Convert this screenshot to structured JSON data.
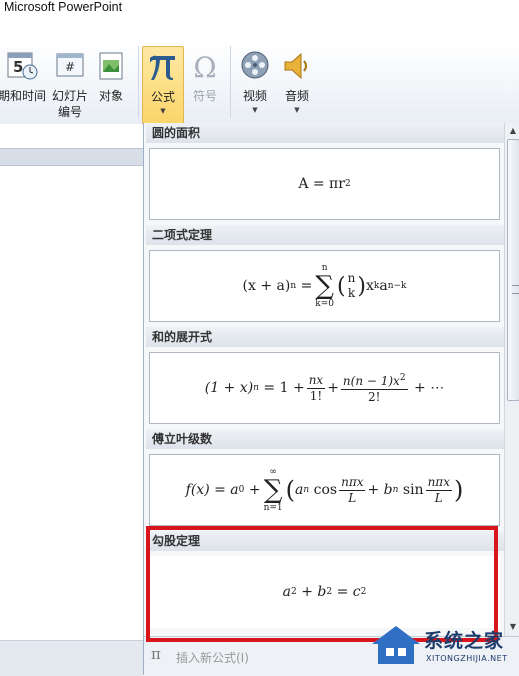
{
  "window": {
    "title": "Microsoft PowerPoint"
  },
  "ribbon": {
    "datetime_label": "期和时间",
    "slide_number_label_line1": "幻灯片",
    "slide_number_label_line2": "编号",
    "object_label": "对象",
    "equation_label": "公式",
    "symbol_label": "符号",
    "video_label": "视频",
    "audio_label": "音频",
    "slide_number_glyph": "#",
    "datetime_glyph": "5"
  },
  "gallery": {
    "sections": [
      {
        "title": "圆的面积"
      },
      {
        "title": "二项式定理"
      },
      {
        "title": "和的展开式"
      },
      {
        "title": "傅立叶级数"
      },
      {
        "title": "勾股定理"
      }
    ],
    "footer": {
      "insert_new_label": "插入新公式(I)"
    }
  },
  "equations": {
    "circle": {
      "lhs": "A = πr",
      "exp": "2"
    },
    "binomial": {
      "lhs": "(x + a)",
      "lhs_exp": "n",
      "eq": "=",
      "sum_top": "n",
      "sum_bottom": "k=0",
      "binom_top": "n",
      "binom_bottom": "k",
      "term_x": "x",
      "exp_k": "k",
      "term_a": "a",
      "exp_nk": "n−k"
    },
    "expansion": {
      "lhs": "(1 + x)",
      "lhs_exp": "n",
      "eq_one": "= 1 +",
      "f1_num": "nx",
      "f1_den": "1!",
      "plus": "+",
      "f2_num": "n(n − 1)x",
      "f2_num_exp": "2",
      "f2_den": "2!",
      "tail": "+ ⋯"
    },
    "fourier": {
      "lhs": "f(x) = a",
      "lhs_sub": "0",
      "plus": "+",
      "sum_top": "∞",
      "sum_bottom": "n=1",
      "a_n": "a",
      "n_sub": "n",
      "cos": "cos",
      "frac_num": "nπx",
      "frac_den": "L",
      "b_n": "+ b",
      "sin": "sin"
    },
    "pythagoras": {
      "a": "a",
      "b": "b",
      "c": "c",
      "exp": "2",
      "plus": "+",
      "eq": "="
    }
  },
  "watermark": {
    "brand": "系统之家",
    "url": "XITONGZHIJIA.NET"
  },
  "colors": {
    "highlight": "#d8151b",
    "active_button": "#fbd56a"
  }
}
